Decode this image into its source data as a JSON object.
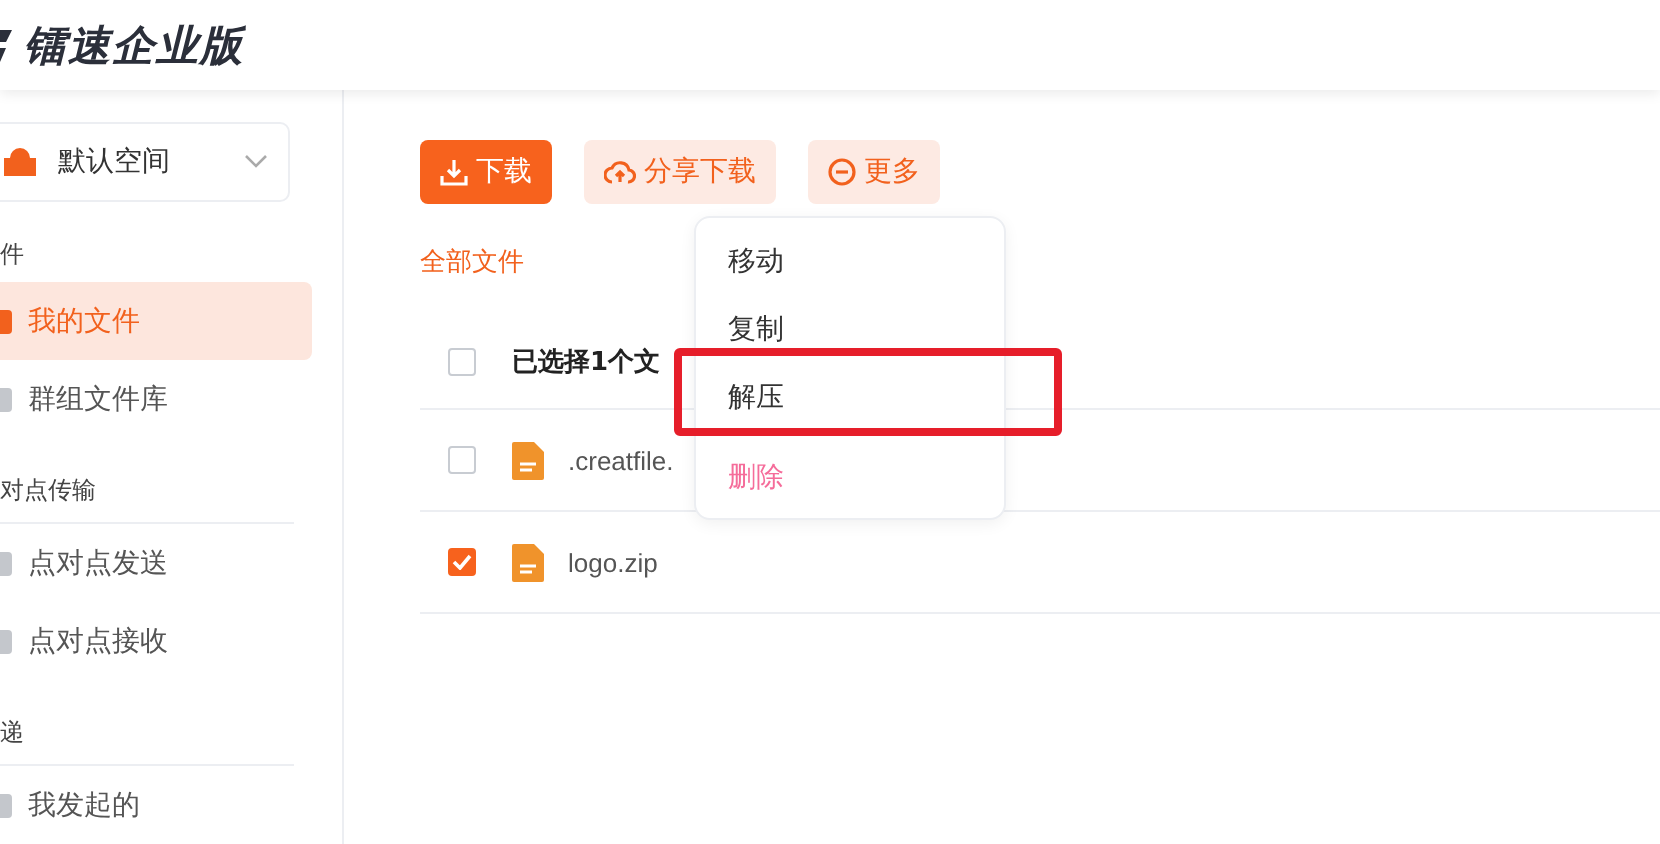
{
  "header": {
    "title": "镭速企业版"
  },
  "sidebar": {
    "space": {
      "label": "默认空间"
    },
    "sections": [
      {
        "title": "件",
        "items": [
          {
            "label": "我的文件",
            "selected": true
          },
          {
            "label": "群组文件库",
            "selected": false
          }
        ]
      },
      {
        "title": "对点传输",
        "items": [
          {
            "label": "点对点发送",
            "selected": false
          },
          {
            "label": "点对点接收",
            "selected": false
          }
        ]
      },
      {
        "title": "递",
        "items": [
          {
            "label": "我发起的",
            "selected": false
          }
        ]
      }
    ]
  },
  "toolbar": [
    {
      "label": "下载",
      "kind": "primary"
    },
    {
      "label": "分享下载",
      "kind": "share"
    },
    {
      "label": "更多",
      "kind": "more"
    }
  ],
  "breadcrumb": "全部文件",
  "table": {
    "header": {
      "label": "已选择1个文",
      "checked": false
    },
    "rows": [
      {
        "name": ".creatfile.",
        "checked": false
      },
      {
        "name": "logo.zip",
        "checked": true
      }
    ]
  },
  "menu": [
    {
      "label": "移动",
      "kind": "normal",
      "annotated": false
    },
    {
      "label": "复制",
      "kind": "normal",
      "annotated": false
    },
    {
      "label": "解压",
      "kind": "normal",
      "annotated": true
    },
    {
      "label": "删除",
      "kind": "danger",
      "annotated": false
    }
  ]
}
